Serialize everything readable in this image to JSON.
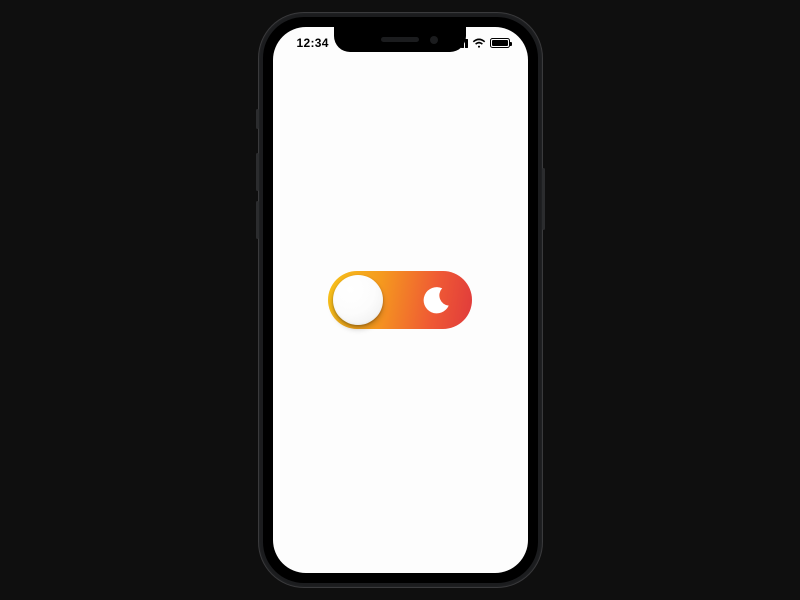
{
  "statusbar": {
    "time": "12:34",
    "signal_bars": 4,
    "wifi": true,
    "battery_pct": 100
  },
  "toggle": {
    "state": "light",
    "left_semantics": "day",
    "right_semantics": "night"
  },
  "colors": {
    "page_bg": "#0f0f0f",
    "screen_bg": "#fdfdfd",
    "grad_start": "#f7c21a",
    "grad_end": "#e03a3c",
    "knob": "#ffffff"
  }
}
